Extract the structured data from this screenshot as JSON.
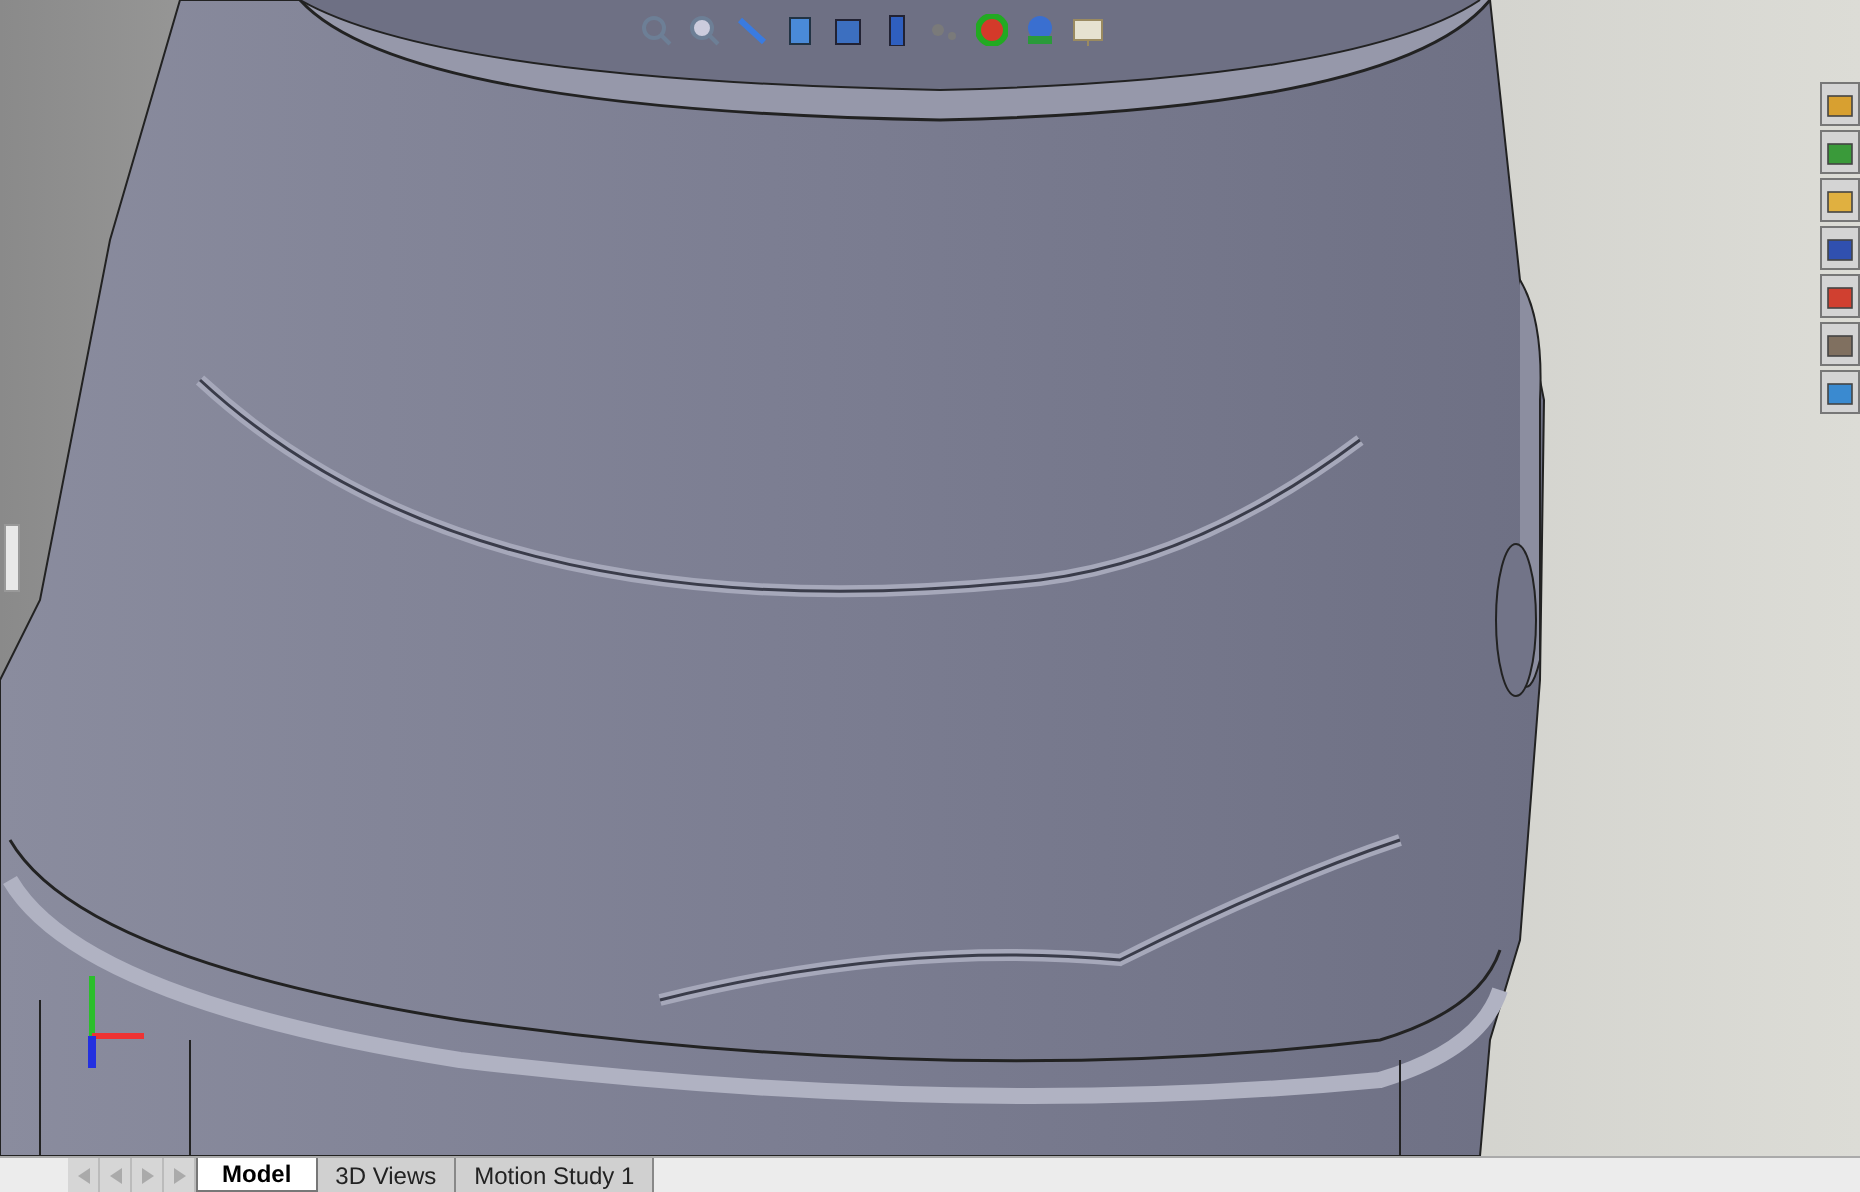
{
  "bottom_tabs": [
    {
      "label": "Model",
      "selected": true
    },
    {
      "label": "3D Views",
      "selected": false
    },
    {
      "label": "Motion Study 1",
      "selected": false
    }
  ]
}
